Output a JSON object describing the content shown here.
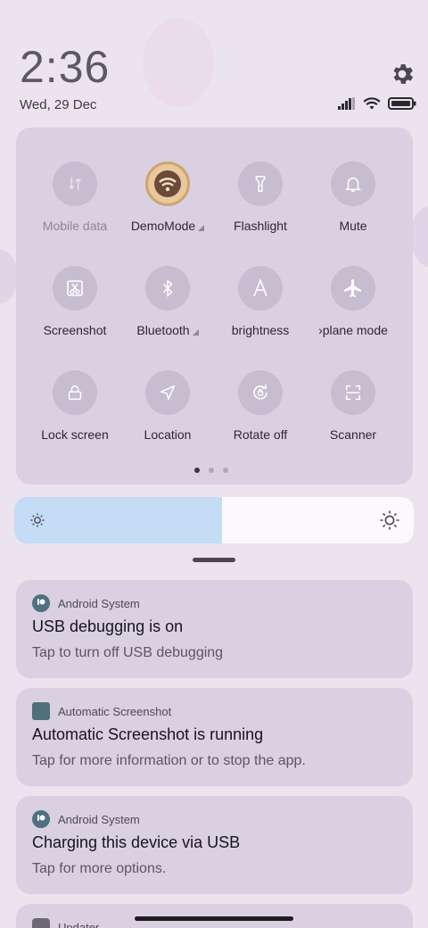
{
  "status": {
    "time": "2:36",
    "date": "Wed, 29 Dec",
    "icons": [
      "signal-icon",
      "wifi-icon",
      "battery-icon"
    ]
  },
  "quick_settings": {
    "tiles": [
      {
        "label": "Mobile data",
        "icon": "mobile-data-icon",
        "enabled": false
      },
      {
        "label": "DemoMode",
        "icon": "demomode-icon",
        "has_menu": true
      },
      {
        "label": "Flashlight",
        "icon": "flashlight-icon"
      },
      {
        "label": "Mute",
        "icon": "bell-icon"
      },
      {
        "label": "Screenshot",
        "icon": "screenshot-icon"
      },
      {
        "label": "Bluetooth",
        "icon": "bluetooth-icon",
        "has_menu": true
      },
      {
        "label": "brightness",
        "icon": "auto-brightness-icon"
      },
      {
        "label": "›plane mode",
        "icon": "airplane-icon"
      },
      {
        "label": "Lock screen",
        "icon": "lock-icon"
      },
      {
        "label": "Location",
        "icon": "location-icon"
      },
      {
        "label": "Rotate off",
        "icon": "rotate-icon"
      },
      {
        "label": "Scanner",
        "icon": "scanner-icon"
      }
    ],
    "page_count": 3,
    "active_page": 1
  },
  "brightness": {
    "level_fraction": 0.52
  },
  "notifications": [
    {
      "app": "Android System",
      "title": "USB debugging is on",
      "text": "Tap to turn off USB debugging",
      "icon": "android-system-icon"
    },
    {
      "app": "Automatic Screenshot",
      "title": "Automatic Screenshot is running",
      "text": "Tap for more information or to stop the app.",
      "icon": "app-square-icon"
    },
    {
      "app": "Android System",
      "title": "Charging this device via USB",
      "text": "Tap for more options.",
      "icon": "android-system-icon"
    },
    {
      "app": "Updater",
      "title": "",
      "text": "",
      "icon": "updater-icon"
    }
  ],
  "colors": {
    "panel": "#d9d0e2",
    "tile_circle": "#c6bdd0",
    "brightness_fill": "#c4dcf5"
  }
}
